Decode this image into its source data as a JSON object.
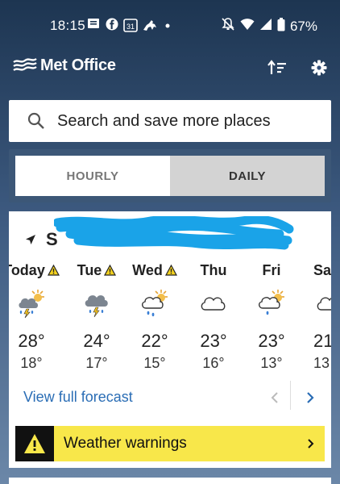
{
  "status_bar": {
    "time": "18:15",
    "notification_icons": [
      "messages-icon",
      "facebook-icon",
      "calendar-icon",
      "horse-icon",
      "dot-icon"
    ],
    "calendar_day": "31",
    "battery": "67%"
  },
  "header": {
    "brand": "Met Office"
  },
  "search": {
    "placeholder": "Search and save more places"
  },
  "toggle": {
    "hourly": "HOURLY",
    "daily": "DAILY",
    "selected": "DAILY"
  },
  "location": {
    "name_visible": "S"
  },
  "days": [
    {
      "name": "Today",
      "warning": true,
      "icon": "thunderstorm-sun-icon",
      "high": "28°",
      "low": "18°"
    },
    {
      "name": "Tue",
      "warning": true,
      "icon": "thunderstorm-icon",
      "high": "24°",
      "low": "17°"
    },
    {
      "name": "Wed",
      "warning": true,
      "icon": "rain-sun-icon",
      "high": "22°",
      "low": "15°"
    },
    {
      "name": "Thu",
      "warning": false,
      "icon": "cloud-icon",
      "high": "23°",
      "low": "16°"
    },
    {
      "name": "Fri",
      "warning": false,
      "icon": "rain-sun-icon",
      "high": "23°",
      "low": "13°"
    },
    {
      "name": "Sa",
      "warning": false,
      "icon": "cloud-icon",
      "high": "21",
      "low": "13"
    }
  ],
  "forecast": {
    "view_full": "View full forecast"
  },
  "warnings": {
    "label": "Weather warnings"
  },
  "colors": {
    "header_bg": "#1d3551",
    "warning_yellow": "#f8e74a",
    "link_blue": "#2a6db5"
  }
}
